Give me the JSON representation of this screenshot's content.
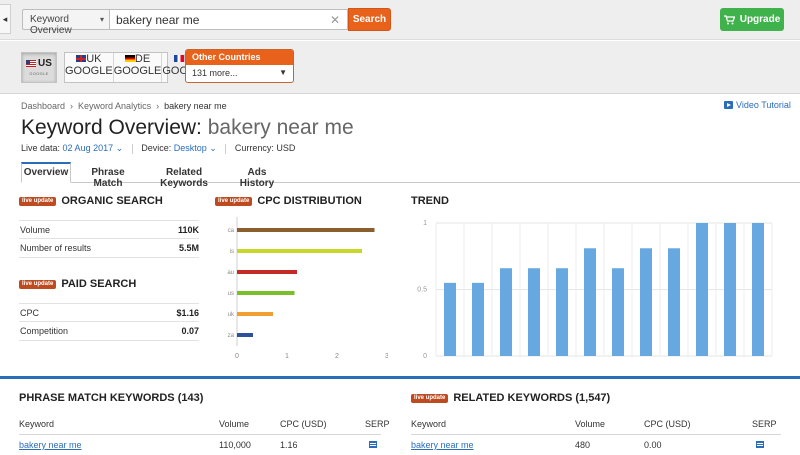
{
  "topbar": {
    "database_select": "Keyword Overview",
    "search_value": "bakery near me",
    "search_button": "Search",
    "upgrade_button": "Upgrade"
  },
  "countries": {
    "items": [
      {
        "code": "US",
        "sub": "GOOGLE",
        "active": true
      },
      {
        "code": "UK",
        "sub": "GOOGLE"
      },
      {
        "code": "DE",
        "sub": "GOOGLE"
      },
      {
        "code": "FR",
        "sub": "GOOGLE"
      }
    ],
    "other_label": "Other Countries",
    "other_value": "131 more..."
  },
  "breadcrumb": [
    "Dashboard",
    "Keyword Analytics",
    "bakery near me"
  ],
  "video_tutorial": "Video Tutorial",
  "title": {
    "prefix": "Keyword Overview:",
    "keyword": "bakery near me"
  },
  "meta": {
    "live_label": "Live data:",
    "live_value": "02 Aug 2017",
    "device_label": "Device:",
    "device_value": "Desktop",
    "currency": "Currency: USD"
  },
  "tabs": [
    "Overview",
    "Phrase Match",
    "Related Keywords",
    "Ads History"
  ],
  "badge": "live update",
  "organic": {
    "title": "ORGANIC SEARCH",
    "rows": [
      {
        "label": "Volume",
        "value": "110K"
      },
      {
        "label": "Number of results",
        "value": "5.5M"
      }
    ]
  },
  "paid": {
    "title": "PAID SEARCH",
    "rows": [
      {
        "label": "CPC",
        "value": "$1.16"
      },
      {
        "label": "Competition",
        "value": "0.07"
      }
    ]
  },
  "cpc_title": "CPC DISTRIBUTION",
  "trend_title": "TREND",
  "chart_data": [
    {
      "type": "bar",
      "orientation": "horizontal",
      "title": "CPC DISTRIBUTION",
      "categories": [
        "ca",
        "is",
        "au",
        "us",
        "uk",
        "za"
      ],
      "values": [
        2.75,
        2.5,
        1.2,
        1.15,
        0.72,
        0.32
      ],
      "colors": [
        "#8b5e2e",
        "#c6d928",
        "#c42b27",
        "#7bbf2a",
        "#f0a030",
        "#2e4f9e"
      ],
      "xticks": [
        "0",
        "1",
        "2",
        "3"
      ],
      "xlim": [
        0,
        3
      ],
      "grid": false
    },
    {
      "type": "bar",
      "title": "TREND",
      "values": [
        0.55,
        0.55,
        0.66,
        0.66,
        0.66,
        0.81,
        0.66,
        0.81,
        0.81,
        1.0,
        1.0,
        1.0
      ],
      "yticks": [
        "0",
        "0.5",
        "1"
      ],
      "ylim": [
        0,
        1
      ],
      "color": "#68a8e0",
      "grid": true
    }
  ],
  "phrase": {
    "title": "PHRASE MATCH KEYWORDS (143)",
    "headers": [
      "Keyword",
      "Volume",
      "CPC (USD)",
      "SERP"
    ],
    "rows": [
      {
        "keyword": "bakery near me",
        "volume": "110,000",
        "cpc": "1.16"
      }
    ]
  },
  "related": {
    "title": "RELATED KEYWORDS (1,547)",
    "headers": [
      "Keyword",
      "Volume",
      "CPC (USD)",
      "SERP"
    ],
    "rows": [
      {
        "keyword": "bakery near me",
        "volume": "480",
        "cpc": "0.00"
      }
    ]
  }
}
